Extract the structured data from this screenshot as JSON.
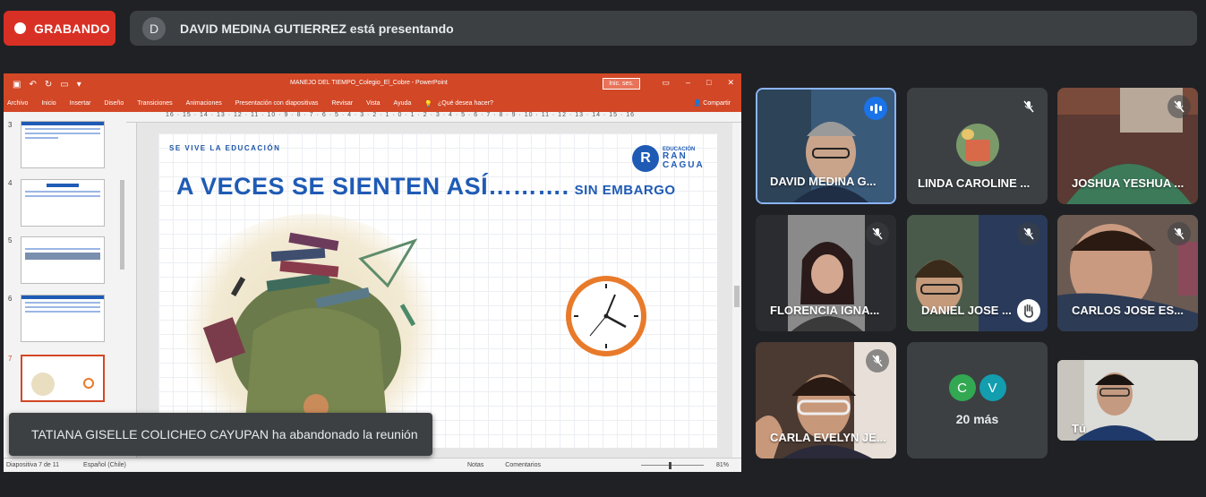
{
  "recording": {
    "label": "GRABANDO"
  },
  "presenting": {
    "avatar_initial": "D",
    "text": "DAVID MEDINA GUTIERREZ está presentando"
  },
  "powerpoint": {
    "doc_title": "MANEJO DEL TIEMPO_Colegio_El_Cobre  -  PowerPoint",
    "sign_in": "Inic. ses.",
    "ribbon_tabs": [
      "Archivo",
      "Inicio",
      "Insertar",
      "Diseño",
      "Transiciones",
      "Animaciones",
      "Presentación con diapositivas",
      "Revisar",
      "Vista",
      "Ayuda"
    ],
    "tell_me": "¿Qué desea hacer?",
    "share": "Compartir",
    "thumb_numbers": [
      "3",
      "4",
      "5",
      "6",
      "7"
    ],
    "ruler_text": "16 · 15 · 14 · 13 · 12 · 11 · 10 · 9 · 8 · 7 · 6 · 5 · 4 · 3 · 2 · 1 · 0 · 1 · 2 · 3 · 4 · 5 · 6 · 7 · 8 · 9 · 10 · 11 · 12 · 13 · 14 · 15 · 16",
    "slide": {
      "tagline": "SE VIVE LA EDUCACIÓN",
      "logo_letter": "R",
      "logo_line1": "EDUCACIÓN",
      "logo_line2": "RAN",
      "logo_line3": "CAGUA",
      "heading": "A VECES SE SIENTEN ASÍ……….",
      "heading_suffix": "SIN EMBARGO"
    },
    "status": {
      "slide_count": "Diapositiva 7 de 11",
      "language": "Español (Chile)",
      "notes": "Notas",
      "comments": "Comentarios",
      "zoom": "81%"
    }
  },
  "toast": "TATIANA GISELLE COLICHEO CAYUPAN ha abandonado la reunión",
  "participants": [
    {
      "name": "DAVID MEDINA G..."
    },
    {
      "name": "LINDA CAROLINE ..."
    },
    {
      "name": "JOSHUA YESHUA ..."
    },
    {
      "name": "FLORENCIA IGNA..."
    },
    {
      "name": "DANIEL JOSE ..."
    },
    {
      "name": "CARLOS JOSE ES..."
    },
    {
      "name": "CARLA EVELYN JE..."
    }
  ],
  "more": {
    "initials": [
      "C",
      "V"
    ],
    "text": "20 más"
  },
  "self": {
    "name": "Tú"
  },
  "colors": {
    "record": "#d93025",
    "ppt": "#d24726",
    "slide_blue": "#1f5bb5",
    "tile_bg": "#3c4043",
    "page_bg": "#202124"
  }
}
